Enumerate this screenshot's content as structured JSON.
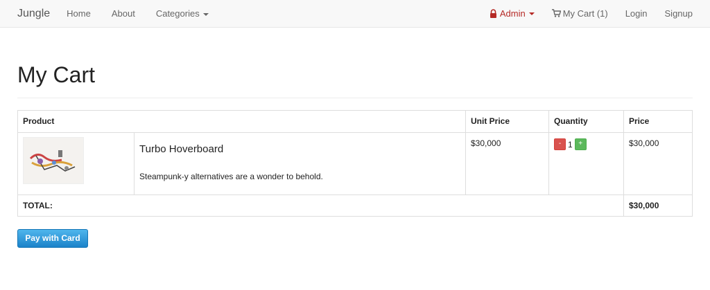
{
  "navbar": {
    "brand": "Jungle",
    "left_items": [
      "Home",
      "About",
      "Categories"
    ],
    "admin_label": "Admin",
    "cart_label": "My Cart (1)",
    "login_label": "Login",
    "signup_label": "Signup"
  },
  "page": {
    "title": "My Cart"
  },
  "table": {
    "headers": {
      "product": "Product",
      "unit_price": "Unit Price",
      "quantity": "Quantity",
      "price": "Price"
    },
    "rows": [
      {
        "name": "Turbo Hoverboard",
        "description": "Steampunk-y alternatives are a wonder to behold.",
        "unit_price": "$30,000",
        "quantity": "1",
        "minus_label": "-",
        "plus_label": "+",
        "price": "$30,000"
      }
    ],
    "total_label": "TOTAL:",
    "total_value": "$30,000"
  },
  "pay_button": "Pay with Card",
  "colors": {
    "admin": "#b52a26",
    "minus": "#d9534f",
    "plus": "#5cb85c",
    "pay": "#1b82c9"
  },
  "icons": [
    "lock-icon",
    "cart-icon",
    "caret-down-icon"
  ]
}
